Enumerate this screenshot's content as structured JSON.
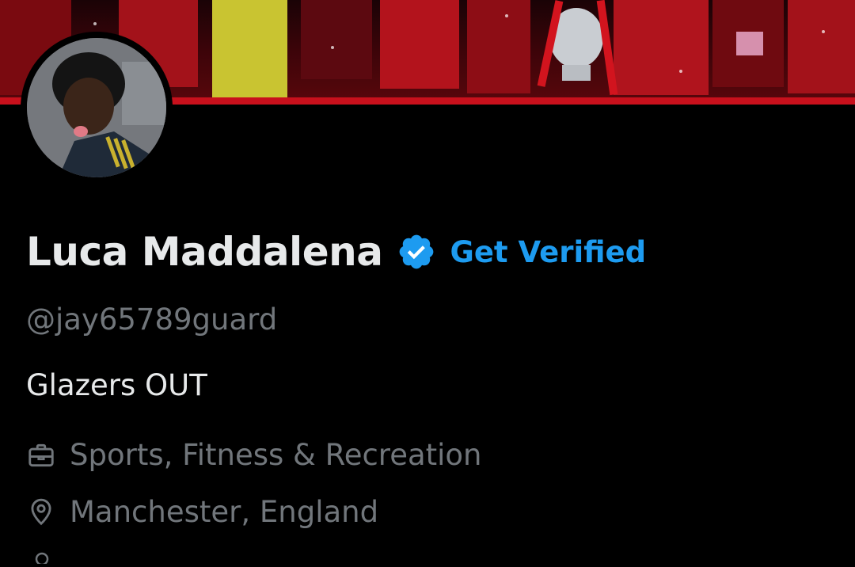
{
  "profile": {
    "display_name": "Luca Maddalena",
    "get_verified_label": "Get Verified",
    "handle": "@jay65789guard",
    "bio": "Glazers OUT",
    "category": "Sports, Fitness & Recreation",
    "location": "Manchester, England"
  },
  "icons": {
    "verified": "verified-badge-icon",
    "category": "briefcase-icon",
    "location": "location-pin-icon"
  },
  "colors": {
    "background": "#000000",
    "primary_text": "#e7e9ea",
    "secondary_text": "#71767b",
    "accent_blue": "#1d9bf0",
    "banner_red": "#c8101c"
  }
}
